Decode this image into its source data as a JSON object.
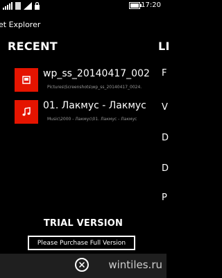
{
  "status_bar": {
    "time": "17:20",
    "icons": [
      "signal-strength-icon",
      "unknown-icon",
      "wifi-icon",
      "lock-icon",
      "battery-icon"
    ]
  },
  "app": {
    "title": "et Explorer"
  },
  "pivots": {
    "recent": "RECENT",
    "next_partial": "LI"
  },
  "recent": {
    "items": [
      {
        "icon": "image-file-icon",
        "title": "wp_ss_20140417_002",
        "path": "Pictures\\Screenshots\\wp_ss_20140417_0024."
      },
      {
        "icon": "music-note-icon",
        "title": "01. Лакмус - Лакмус",
        "path": "Music\\2000 - Лакмус\\01. Лакмус - Лакмус"
      }
    ]
  },
  "side_letters": [
    "F",
    "V",
    "D",
    "D",
    "P"
  ],
  "trial": {
    "label": "TRIAL VERSION",
    "purchase_button": "Please Purchase Full Version"
  },
  "app_bar": {
    "close_icon": "close-icon",
    "watermark": "wintiles.ru"
  },
  "colors": {
    "accent": "#e51400",
    "background": "#000000",
    "app_bar": "#1f1f1f",
    "path_text": "#9a9a9a"
  }
}
